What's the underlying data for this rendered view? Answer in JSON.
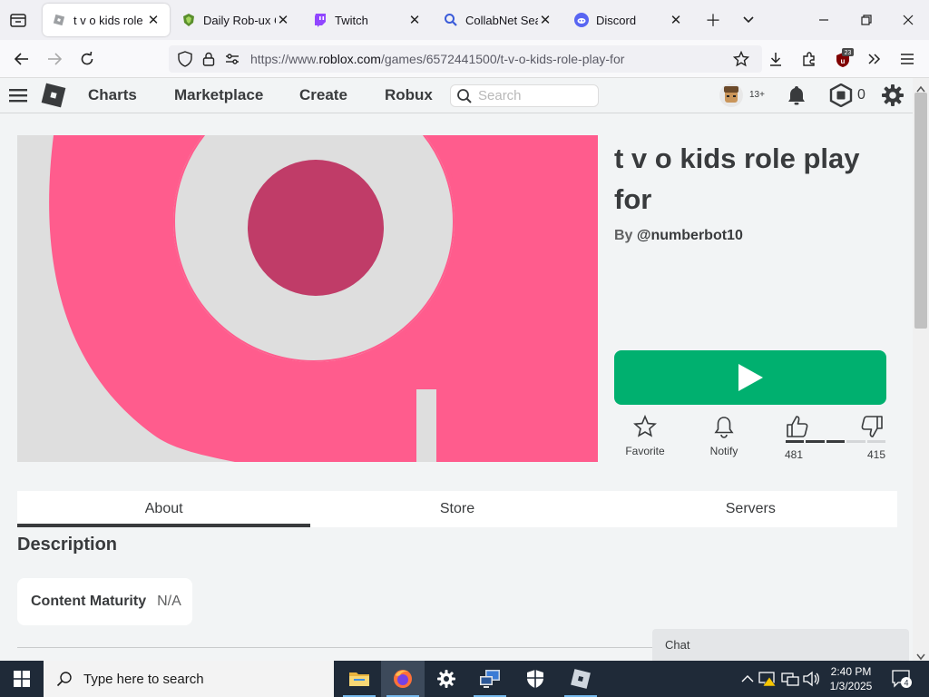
{
  "browser": {
    "tabs": [
      {
        "title": "t v o kids role pl",
        "favicon": "roblox-favicon",
        "active": true
      },
      {
        "title": "Daily Rob-ux Co",
        "favicon": "shield-favicon",
        "active": false
      },
      {
        "title": "Twitch",
        "favicon": "twitch-favicon",
        "active": false
      },
      {
        "title": "CollabNet Searc",
        "favicon": "search-favicon",
        "active": false
      },
      {
        "title": "Discord",
        "favicon": "discord-favicon",
        "active": false
      }
    ],
    "url_prefix": "https://www.",
    "url_domain": "roblox.com",
    "url_path": "/games/6572441500/t-v-o-kids-role-play-for",
    "extension_badge": "23"
  },
  "header": {
    "nav": [
      "Charts",
      "Marketplace",
      "Create",
      "Robux"
    ],
    "search_placeholder": "Search",
    "age_badge": "13+",
    "robux_balance": "0"
  },
  "game": {
    "title": "t v o kids role play for",
    "by_label": "By",
    "creator": "@numberbot10",
    "actions": {
      "favorite": "Favorite",
      "notify": "Notify"
    },
    "upvotes": "481",
    "downvotes": "415",
    "like_ratio": 0.537
  },
  "tabs": [
    "About",
    "Store",
    "Servers"
  ],
  "description_heading": "Description",
  "content_maturity": {
    "label": "Content Maturity",
    "value": "N/A"
  },
  "chat_label": "Chat",
  "taskbar": {
    "search_placeholder": "Type here to search",
    "time": "2:40 PM",
    "date": "1/3/2025",
    "notification_count": "4"
  },
  "colors": {
    "play_button": "#00b06f",
    "thumbnail_pink": "#ff5c8d",
    "thumbnail_grey": "#dedede",
    "thumbnail_dot": "#c03c68"
  }
}
